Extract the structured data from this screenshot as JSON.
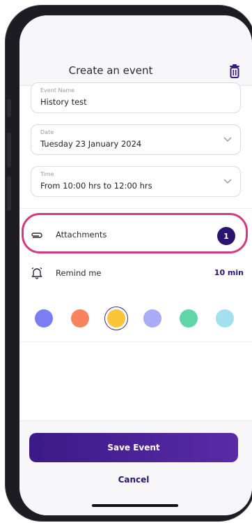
{
  "header": {
    "title": "Create an event",
    "delete_icon": "trash-icon"
  },
  "fields": {
    "event_name": {
      "label": "Event Name",
      "value": "History test"
    },
    "date": {
      "label": "Date",
      "value": "Tuesday 23 January 2024"
    },
    "time": {
      "label": "Time",
      "value": "From 10:00 hrs to 12:00 hrs"
    }
  },
  "attachments": {
    "label": "Attachments",
    "count": "1",
    "icon": "paperclip-icon",
    "highlight_color": "#d63a7e"
  },
  "remind": {
    "label": "Remind me",
    "value": "10 min",
    "icon": "alarm-icon"
  },
  "colors": {
    "options": [
      "#7b7ef2",
      "#f7845f",
      "#fbc53a",
      "#a9abf4",
      "#5fd6a6",
      "#a4dff0"
    ],
    "selected_index": 2
  },
  "actions": {
    "save_label": "Save Event",
    "cancel_label": "Cancel"
  },
  "accent": "#2b1470"
}
